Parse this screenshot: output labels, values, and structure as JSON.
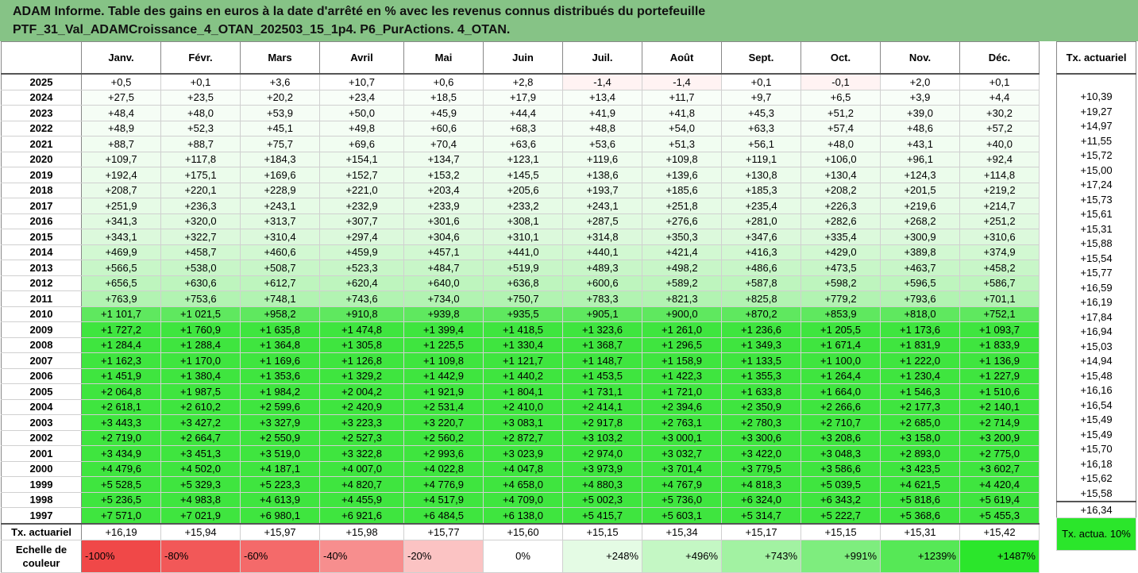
{
  "title": {
    "line1": "ADAM Informe. Table des gains en euros à la date d'arrêté en % avec les revenus connus distribués du portefeuille",
    "line2": "PTF_31_Val_ADAMCroissance_4_OTAN_202503_15_1p4. P6_PurActions. 4_OTAN."
  },
  "months": [
    "Janv.",
    "Févr.",
    "Mars",
    "Avril",
    "Mai",
    "Juin",
    "Juil.",
    "Août",
    "Sept.",
    "Oct.",
    "Nov.",
    "Déc."
  ],
  "side_header": "Tx. actuariel",
  "rows": [
    {
      "year": "2025",
      "values": [
        "+0,5",
        "+0,1",
        "+3,6",
        "+10,7",
        "+0,6",
        "+2,8",
        "-1,4",
        "-1,4",
        "+0,1",
        "-0,1",
        "+2,0",
        "+0,1"
      ],
      "tx": ""
    },
    {
      "year": "2024",
      "values": [
        "+27,5",
        "+23,5",
        "+20,2",
        "+23,4",
        "+18,5",
        "+17,9",
        "+13,4",
        "+11,7",
        "+9,7",
        "+6,5",
        "+3,9",
        "+4,4"
      ],
      "tx": "+10,39"
    },
    {
      "year": "2023",
      "values": [
        "+48,4",
        "+48,0",
        "+53,9",
        "+50,0",
        "+45,9",
        "+44,4",
        "+41,9",
        "+41,8",
        "+45,3",
        "+51,2",
        "+39,0",
        "+30,2"
      ],
      "tx": "+19,27"
    },
    {
      "year": "2022",
      "values": [
        "+48,9",
        "+52,3",
        "+45,1",
        "+49,8",
        "+60,6",
        "+68,3",
        "+48,8",
        "+54,0",
        "+63,3",
        "+57,4",
        "+48,6",
        "+57,2"
      ],
      "tx": "+14,97"
    },
    {
      "year": "2021",
      "values": [
        "+88,7",
        "+88,7",
        "+75,7",
        "+69,6",
        "+70,4",
        "+63,6",
        "+53,6",
        "+51,3",
        "+56,1",
        "+48,0",
        "+43,1",
        "+40,0"
      ],
      "tx": "+11,55"
    },
    {
      "year": "2020",
      "values": [
        "+109,7",
        "+117,8",
        "+184,3",
        "+154,1",
        "+134,7",
        "+123,1",
        "+119,6",
        "+109,8",
        "+119,1",
        "+106,0",
        "+96,1",
        "+92,4"
      ],
      "tx": "+15,72"
    },
    {
      "year": "2019",
      "values": [
        "+192,4",
        "+175,1",
        "+169,6",
        "+152,7",
        "+153,2",
        "+145,5",
        "+138,6",
        "+139,6",
        "+130,8",
        "+130,4",
        "+124,3",
        "+114,8"
      ],
      "tx": "+15,00"
    },
    {
      "year": "2018",
      "values": [
        "+208,7",
        "+220,1",
        "+228,9",
        "+221,0",
        "+203,4",
        "+205,6",
        "+193,7",
        "+185,6",
        "+185,3",
        "+208,2",
        "+201,5",
        "+219,2"
      ],
      "tx": "+17,24"
    },
    {
      "year": "2017",
      "values": [
        "+251,9",
        "+236,3",
        "+243,1",
        "+232,9",
        "+233,9",
        "+233,2",
        "+243,1",
        "+251,8",
        "+235,4",
        "+226,3",
        "+219,6",
        "+214,7"
      ],
      "tx": "+15,73"
    },
    {
      "year": "2016",
      "values": [
        "+341,3",
        "+320,0",
        "+313,7",
        "+307,7",
        "+301,6",
        "+308,1",
        "+287,5",
        "+276,6",
        "+281,0",
        "+282,6",
        "+268,2",
        "+251,2"
      ],
      "tx": "+15,61"
    },
    {
      "year": "2015",
      "values": [
        "+343,1",
        "+322,7",
        "+310,4",
        "+297,4",
        "+304,6",
        "+310,1",
        "+314,8",
        "+350,3",
        "+347,6",
        "+335,4",
        "+300,9",
        "+310,6"
      ],
      "tx": "+15,31"
    },
    {
      "year": "2014",
      "values": [
        "+469,9",
        "+458,7",
        "+460,6",
        "+459,9",
        "+457,1",
        "+441,0",
        "+440,1",
        "+421,4",
        "+416,3",
        "+429,0",
        "+389,8",
        "+374,9"
      ],
      "tx": "+15,88"
    },
    {
      "year": "2013",
      "values": [
        "+566,5",
        "+538,0",
        "+508,7",
        "+523,3",
        "+484,7",
        "+519,9",
        "+489,3",
        "+498,2",
        "+486,6",
        "+473,5",
        "+463,7",
        "+458,2"
      ],
      "tx": "+15,54"
    },
    {
      "year": "2012",
      "values": [
        "+656,5",
        "+630,6",
        "+612,7",
        "+620,4",
        "+640,0",
        "+636,8",
        "+600,6",
        "+589,2",
        "+587,8",
        "+598,2",
        "+596,5",
        "+586,7"
      ],
      "tx": "+15,77"
    },
    {
      "year": "2011",
      "values": [
        "+763,9",
        "+753,6",
        "+748,1",
        "+743,6",
        "+734,0",
        "+750,7",
        "+783,3",
        "+821,3",
        "+825,8",
        "+779,2",
        "+793,6",
        "+701,1"
      ],
      "tx": "+16,59"
    },
    {
      "year": "2010",
      "values": [
        "+1 101,7",
        "+1 021,5",
        "+958,2",
        "+910,8",
        "+939,8",
        "+935,5",
        "+905,1",
        "+900,0",
        "+870,2",
        "+853,9",
        "+818,0",
        "+752,1"
      ],
      "tx": "+16,19"
    },
    {
      "year": "2009",
      "values": [
        "+1 727,2",
        "+1 760,9",
        "+1 635,8",
        "+1 474,8",
        "+1 399,4",
        "+1 418,5",
        "+1 323,6",
        "+1 261,0",
        "+1 236,6",
        "+1 205,5",
        "+1 173,6",
        "+1 093,7"
      ],
      "tx": "+17,84"
    },
    {
      "year": "2008",
      "values": [
        "+1 284,4",
        "+1 288,4",
        "+1 364,8",
        "+1 305,8",
        "+1 225,5",
        "+1 330,4",
        "+1 368,7",
        "+1 296,5",
        "+1 349,3",
        "+1 671,4",
        "+1 831,9",
        "+1 833,9"
      ],
      "tx": "+16,94"
    },
    {
      "year": "2007",
      "values": [
        "+1 162,3",
        "+1 170,0",
        "+1 169,6",
        "+1 126,8",
        "+1 109,8",
        "+1 121,7",
        "+1 148,7",
        "+1 158,9",
        "+1 133,5",
        "+1 100,0",
        "+1 222,0",
        "+1 136,9"
      ],
      "tx": "+15,03"
    },
    {
      "year": "2006",
      "values": [
        "+1 451,9",
        "+1 380,4",
        "+1 353,6",
        "+1 329,2",
        "+1 442,9",
        "+1 440,2",
        "+1 453,5",
        "+1 422,3",
        "+1 355,3",
        "+1 264,4",
        "+1 230,4",
        "+1 227,9"
      ],
      "tx": "+14,94"
    },
    {
      "year": "2005",
      "values": [
        "+2 064,8",
        "+1 987,5",
        "+1 984,2",
        "+2 004,2",
        "+1 921,9",
        "+1 804,1",
        "+1 731,1",
        "+1 721,0",
        "+1 633,8",
        "+1 664,0",
        "+1 546,3",
        "+1 510,6"
      ],
      "tx": "+15,48"
    },
    {
      "year": "2004",
      "values": [
        "+2 618,1",
        "+2 610,2",
        "+2 599,6",
        "+2 420,9",
        "+2 531,4",
        "+2 410,0",
        "+2 414,1",
        "+2 394,6",
        "+2 350,9",
        "+2 266,6",
        "+2 177,3",
        "+2 140,1"
      ],
      "tx": "+16,16"
    },
    {
      "year": "2003",
      "values": [
        "+3 443,3",
        "+3 427,2",
        "+3 327,9",
        "+3 223,3",
        "+3 220,7",
        "+3 083,1",
        "+2 917,8",
        "+2 763,1",
        "+2 780,3",
        "+2 710,7",
        "+2 685,0",
        "+2 714,9"
      ],
      "tx": "+16,54"
    },
    {
      "year": "2002",
      "values": [
        "+2 719,0",
        "+2 664,7",
        "+2 550,9",
        "+2 527,3",
        "+2 560,2",
        "+2 872,7",
        "+3 103,2",
        "+3 000,1",
        "+3 300,6",
        "+3 208,6",
        "+3 158,0",
        "+3 200,9"
      ],
      "tx": "+15,49"
    },
    {
      "year": "2001",
      "values": [
        "+3 434,9",
        "+3 451,3",
        "+3 519,0",
        "+3 322,8",
        "+2 993,6",
        "+3 023,9",
        "+2 974,0",
        "+3 032,7",
        "+3 422,0",
        "+3 048,3",
        "+2 893,0",
        "+2 775,0"
      ],
      "tx": "+15,49"
    },
    {
      "year": "2000",
      "values": [
        "+4 479,6",
        "+4 502,0",
        "+4 187,1",
        "+4 007,0",
        "+4 022,8",
        "+4 047,8",
        "+3 973,9",
        "+3 701,4",
        "+3 779,5",
        "+3 586,6",
        "+3 423,5",
        "+3 602,7"
      ],
      "tx": "+15,70"
    },
    {
      "year": "1999",
      "values": [
        "+5 528,5",
        "+5 329,3",
        "+5 223,3",
        "+4 820,7",
        "+4 776,9",
        "+4 658,0",
        "+4 880,3",
        "+4 767,9",
        "+4 818,3",
        "+5 039,5",
        "+4 621,5",
        "+4 420,4"
      ],
      "tx": "+16,18"
    },
    {
      "year": "1998",
      "values": [
        "+5 236,5",
        "+4 983,8",
        "+4 613,9",
        "+4 455,9",
        "+4 517,9",
        "+4 709,0",
        "+5 002,3",
        "+5 736,0",
        "+6 324,0",
        "+6 343,2",
        "+5 818,6",
        "+5 619,4"
      ],
      "tx": "+15,62"
    },
    {
      "year": "1997",
      "values": [
        "+7 571,0",
        "+7 021,9",
        "+6 980,1",
        "+6 921,6",
        "+6 484,5",
        "+6 138,0",
        "+5 415,7",
        "+5 603,1",
        "+5 314,7",
        "+5 222,7",
        "+5 368,6",
        "+5 455,3"
      ],
      "tx": "+15,58"
    }
  ],
  "tx_row": {
    "label": "Tx. actuariel",
    "values": [
      "+16,19",
      "+15,94",
      "+15,97",
      "+15,98",
      "+15,77",
      "+15,60",
      "+15,15",
      "+15,34",
      "+15,17",
      "+15,15",
      "+15,31",
      "+15,42"
    ],
    "total": "+16,34"
  },
  "scale": {
    "label": "Echelle de couleur",
    "items": [
      {
        "text": "-100%",
        "color": "#f04848"
      },
      {
        "text": "-80%",
        "color": "#f25858"
      },
      {
        "text": "-60%",
        "color": "#f46a6a"
      },
      {
        "text": "-40%",
        "color": "#f78e8e"
      },
      {
        "text": "-20%",
        "color": "#fbc3c3"
      },
      {
        "text": "0%",
        "color": "#ffffff"
      },
      {
        "text": "+248%",
        "color": "#e4fbe4"
      },
      {
        "text": "+496%",
        "color": "#c4f7c4"
      },
      {
        "text": "+743%",
        "color": "#a2f2a2"
      },
      {
        "text": "+991%",
        "color": "#7eed7e"
      },
      {
        "text": "+1239%",
        "color": "#56e856"
      },
      {
        "text": "+1487%",
        "color": "#2be62b"
      }
    ],
    "side": "Tx. actua. 10%"
  },
  "row_colors": {
    "2025": "#ffffff",
    "2024": "#f8fef8",
    "2023": "#f5fdf5",
    "2022": "#f4fdf4",
    "2021": "#f1fdf1",
    "2020": "#eefcee",
    "2019": "#ebfceb",
    "2018": "#e9fbe9",
    "2017": "#e6fbe6",
    "2016": "#e1fae1",
    "2015": "#dcf9dc",
    "2014": "#d2f8d2",
    "2013": "#c8f6c8",
    "2012": "#bef5be",
    "2011": "#b2f3b2",
    "2010": "#5fe85f",
    "2009": "#3fe53f",
    "2008": "#3fe53f",
    "2007": "#3fe53f",
    "2006": "#3fe53f",
    "2005": "#3fe53f",
    "2004": "#3fe53f",
    "2003": "#3fe53f",
    "2002": "#3fe53f",
    "2001": "#3fe53f",
    "2000": "#3fe53f",
    "1999": "#3fe53f",
    "1998": "#3fe53f",
    "1997": "#3fe53f"
  },
  "negative_color": "#fff3f3"
}
